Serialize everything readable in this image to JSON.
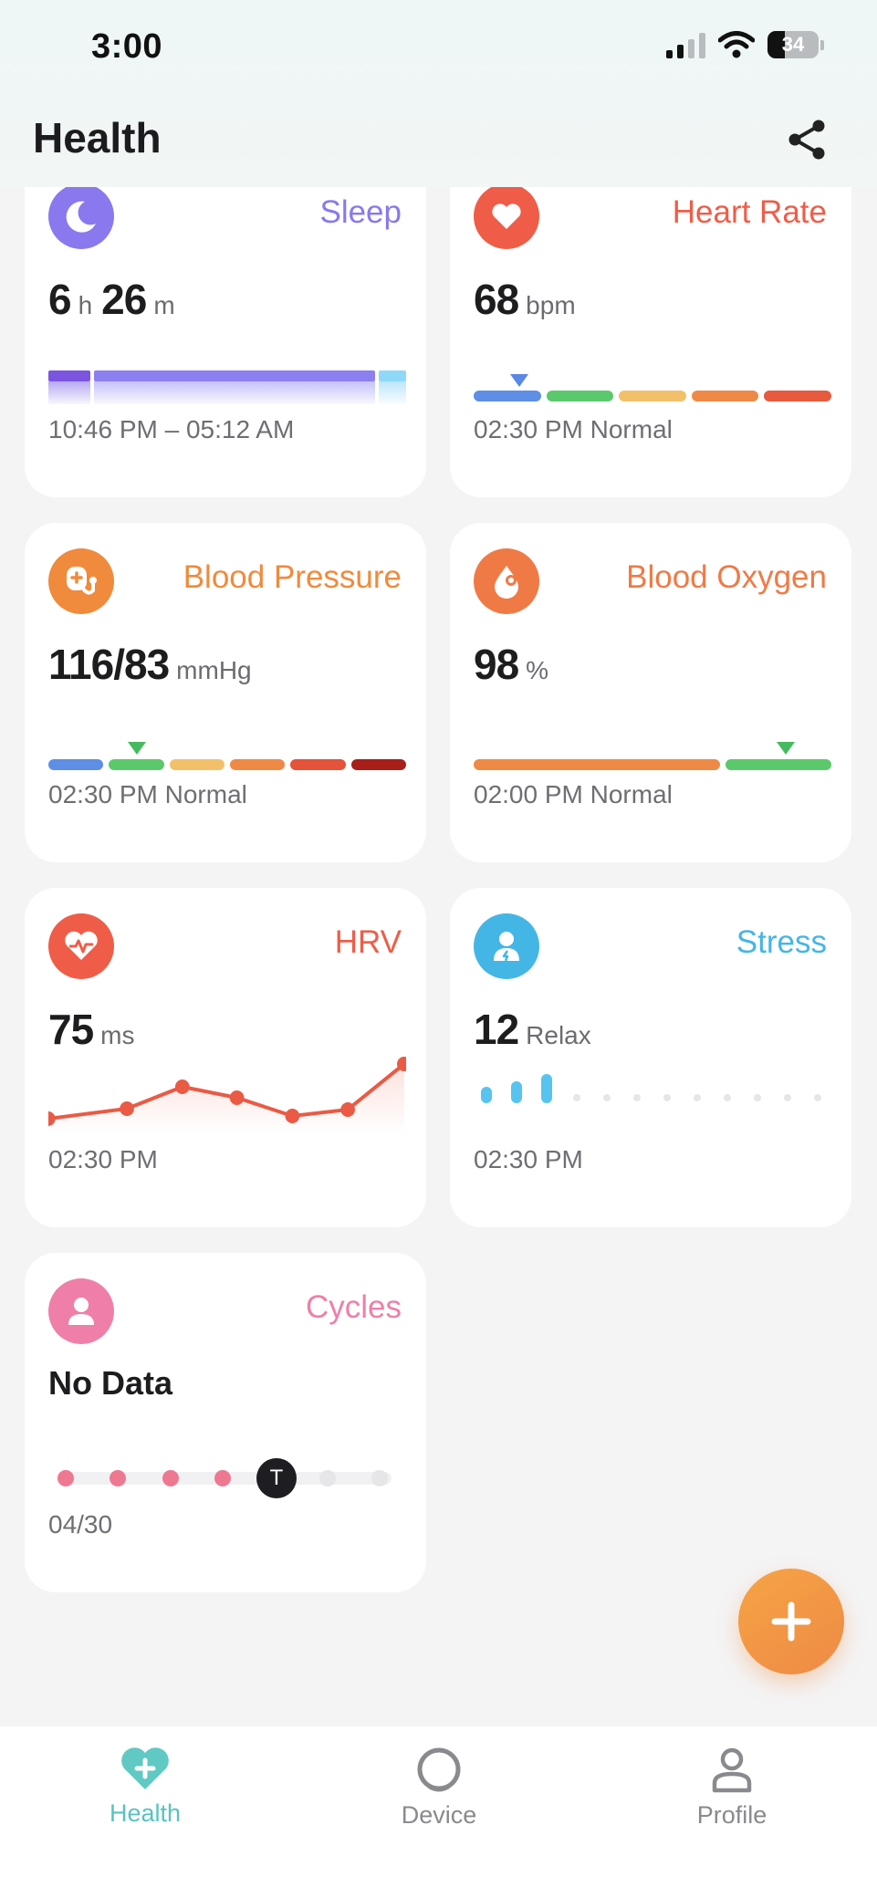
{
  "status_bar": {
    "time": "3:00",
    "battery": "34"
  },
  "header": {
    "title": "Health"
  },
  "cards": {
    "sleep": {
      "name": "Sleep",
      "hours": "6",
      "hours_unit": "h",
      "minutes": "26",
      "minutes_unit": "m",
      "footer": "10:46 PM – 05:12 AM",
      "color": "#8a78ee"
    },
    "heart_rate": {
      "name": "Heart Rate",
      "value": "68",
      "unit": "bpm",
      "footer": "02:30 PM Normal",
      "color": "#ef5d48",
      "level_index": 0
    },
    "blood_pressure": {
      "name": "Blood Pressure",
      "value": "116/83",
      "unit": "mmHg",
      "footer": "02:30 PM Normal",
      "color": "#f08a3c",
      "level_index": 1
    },
    "blood_oxygen": {
      "name": "Blood Oxygen",
      "value": "98",
      "unit": "%",
      "footer": "02:00 PM Normal",
      "color": "#f07a45"
    },
    "hrv": {
      "name": "HRV",
      "value": "75",
      "unit": "ms",
      "footer": "02:30 PM",
      "color": "#ef5d48"
    },
    "stress": {
      "name": "Stress",
      "value": "12",
      "unit": "Relax",
      "footer": "02:30 PM",
      "color": "#44b6e6"
    },
    "cycles": {
      "name": "Cycles",
      "value": "No Data",
      "footer": "04/30",
      "today_marker": "T",
      "color": "#ef7fa8"
    }
  },
  "tabs": [
    {
      "label": "Health",
      "active": true
    },
    {
      "label": "Device",
      "active": false
    },
    {
      "label": "Profile",
      "active": false
    }
  ]
}
